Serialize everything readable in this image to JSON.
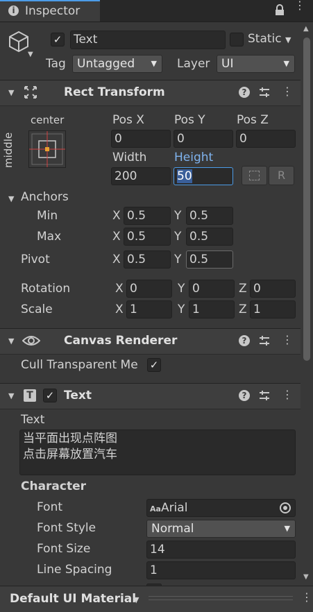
{
  "tab": {
    "title": "Inspector"
  },
  "object": {
    "active": true,
    "name": "Text",
    "static_label": "Static",
    "tag_label": "Tag",
    "tag_value": "Untagged",
    "layer_label": "Layer",
    "layer_value": "UI"
  },
  "rect_transform": {
    "title": "Rect Transform",
    "anchor_h": "center",
    "anchor_v": "middle",
    "pos_x_label": "Pos X",
    "pos_y_label": "Pos Y",
    "pos_z_label": "Pos Z",
    "pos_x": "0",
    "pos_y": "0",
    "pos_z": "0",
    "width_label": "Width",
    "height_label": "Height",
    "width": "200",
    "height": "50",
    "r_button": "R",
    "anchors_label": "Anchors",
    "min_label": "Min",
    "max_label": "Max",
    "pivot_label": "Pivot",
    "x_label": "X",
    "y_label": "Y",
    "z_label": "Z",
    "min_x": "0.5",
    "min_y": "0.5",
    "max_x": "0.5",
    "max_y": "0.5",
    "pivot_x": "0.5",
    "pivot_y": "0.5",
    "rotation_label": "Rotation",
    "rot_x": "0",
    "rot_y": "0",
    "rot_z": "0",
    "scale_label": "Scale",
    "scale_x": "1",
    "scale_y": "1",
    "scale_z": "1"
  },
  "canvas_renderer": {
    "title": "Canvas Renderer",
    "cull_label": "Cull Transparent Me",
    "cull": true
  },
  "text_component": {
    "title": "Text",
    "enabled": true,
    "text_label": "Text",
    "text_line1": "当平面出现点阵图",
    "text_line2": "点击屏幕放置汽车",
    "character_label": "Character",
    "font_label": "Font",
    "font_value": "Arial",
    "font_prefix": "Aa",
    "font_style_label": "Font Style",
    "font_style_value": "Normal",
    "font_size_label": "Font Size",
    "font_size_value": "14",
    "line_spacing_label": "Line Spacing",
    "line_spacing_value": "1"
  },
  "material": {
    "label": "Default UI Material"
  },
  "colors": {
    "background": "#383838",
    "header": "#3e3e3e",
    "field": "#2a2a2a",
    "accent": "#4c9ce8",
    "selection": "#3a5f9a"
  }
}
